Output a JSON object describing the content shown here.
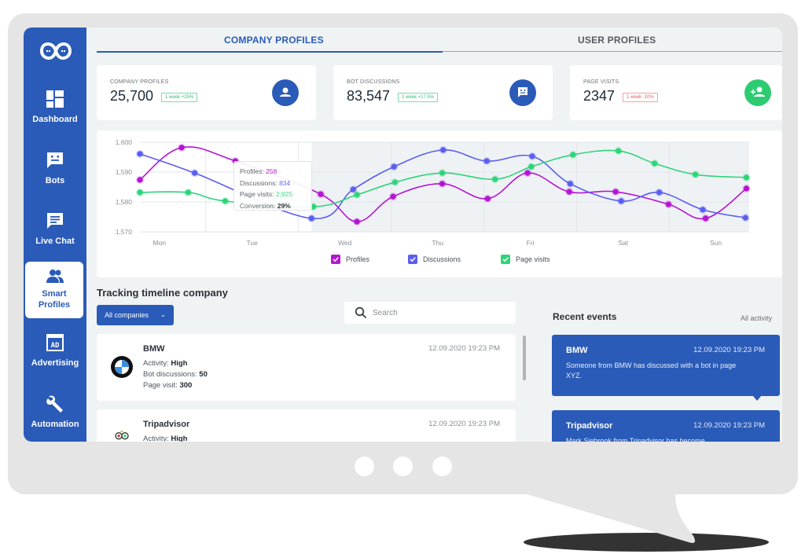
{
  "sidebar": {
    "logo": "infinity-chat-logo",
    "items": [
      {
        "label": "Dashboard",
        "icon": "dashboard-icon",
        "active": false
      },
      {
        "label": "Bots",
        "icon": "bot-chat-icon",
        "active": false
      },
      {
        "label": "Live Chat",
        "icon": "live-chat-icon",
        "active": false
      },
      {
        "label": "Smart\nProfiles",
        "label_line1": "Smart",
        "label_line2": "Profiles",
        "icon": "users-icon",
        "active": true
      },
      {
        "label": "Advertising",
        "icon": "ad-icon",
        "active": false
      },
      {
        "label": "Automation",
        "icon": "wrench-icon",
        "active": false
      }
    ]
  },
  "tabs": [
    {
      "label": "COMPANY PROFILES",
      "active": true
    },
    {
      "label": "USER PROFILES",
      "active": false
    }
  ],
  "stats": [
    {
      "title": "COMPANY PROFILES",
      "value": "25,700",
      "badge": "1 week +25%",
      "trend": "up",
      "icon": "person-icon",
      "icon_color": "#2a5bb8"
    },
    {
      "title": "BOT DISCUSSIONS",
      "value": "83,547",
      "badge": "1 week +17.5%",
      "trend": "up",
      "icon": "bot-chat-icon",
      "icon_color": "#2a5bb8"
    },
    {
      "title": "PAGE VISITS",
      "value": "2347",
      "badge": "1 week -10%",
      "trend": "down",
      "icon": "add-person-icon",
      "icon_color": "#2ecc71"
    }
  ],
  "chart_data": {
    "type": "line",
    "title": "",
    "xlabel": "",
    "ylabel": "",
    "categories": [
      "Mon",
      "Tue",
      "Wed",
      "Thu",
      "Fri",
      "Sat",
      "Sun"
    ],
    "xlim": [
      -0.21,
      6.36
    ],
    "ylim": [
      1570,
      1600
    ],
    "yticks": [
      1570,
      1580,
      1590,
      1600
    ],
    "ytick_labels": [
      "1,570",
      "1,580",
      "1,590",
      "1,600"
    ],
    "grid": true,
    "legend_position": "bottom",
    "smooth": true,
    "highlight_range": [
      1.64,
      6.36
    ],
    "series": [
      {
        "name": "Profiles",
        "color": "#b515d4",
        "x": [
          -0.21,
          0.24,
          0.82,
          1.74,
          2.13,
          2.52,
          3.05,
          3.54,
          3.97,
          4.42,
          4.92,
          5.49,
          5.89,
          6.33
        ],
        "values": [
          1587.4,
          1598.2,
          1593.7,
          1582.6,
          1573.4,
          1581.8,
          1586.1,
          1581.1,
          1589.7,
          1583.4,
          1583.4,
          1579.2,
          1574.5,
          1584.5
        ]
      },
      {
        "name": "Discussions",
        "color": "#5a5ef0",
        "x": [
          -0.21,
          0.38,
          1.64,
          2.09,
          2.53,
          3.06,
          3.53,
          4.02,
          4.43,
          4.98,
          5.39,
          5.86,
          6.32
        ],
        "values": [
          1596.1,
          1589.7,
          1574.5,
          1584.2,
          1591.8,
          1597.4,
          1593.7,
          1595.3,
          1586.1,
          1580.3,
          1583.2,
          1577.4,
          1574.7
        ]
      },
      {
        "name": "Page visits",
        "color": "#2ed47a",
        "x": [
          -0.21,
          0.31,
          0.71,
          1.66,
          2.13,
          2.54,
          3.05,
          3.62,
          4.01,
          4.46,
          4.95,
          5.34,
          5.78,
          6.33
        ],
        "values": [
          1583.2,
          1583.2,
          1580.3,
          1578.4,
          1582.4,
          1586.6,
          1589.7,
          1587.6,
          1591.8,
          1595.8,
          1597.1,
          1592.9,
          1589.2,
          1588.2
        ]
      }
    ],
    "tooltip": {
      "rows": [
        {
          "label": "Profiles: ",
          "value": "258",
          "color": "#b515d4"
        },
        {
          "label": "Discussions: ",
          "value": "834",
          "color": "#5a5ef0"
        },
        {
          "label": "Page visits: ",
          "value": "2,925",
          "color": "#2ed47a"
        },
        {
          "label": "Conversion: ",
          "value": "29%",
          "color": "#1f252c"
        }
      ]
    }
  },
  "tracking": {
    "title": "Tracking timeline company",
    "filter_label": "All companies",
    "search_placeholder": "Search",
    "items": [
      {
        "name": "BMW",
        "timestamp": "12.09.2020 19:23 PM",
        "logo": "bmw-logo",
        "lines": [
          {
            "label": "Activity: ",
            "value": "High"
          },
          {
            "label": "Bot discussions: ",
            "value": "50"
          },
          {
            "label": "Page visit: ",
            "value": "300"
          }
        ]
      },
      {
        "name": "Tripadvisor",
        "timestamp": "12.09.2020 19:23 PM",
        "logo": "tripadvisor-logo",
        "lines": [
          {
            "label": "Activity: ",
            "value": "High"
          }
        ]
      }
    ]
  },
  "recent": {
    "title": "Recent events",
    "all_label": "All activity",
    "events": [
      {
        "name": "BMW",
        "timestamp": "12.09.2020 19:23 PM",
        "text": "Someone from BMW has discussed with a bot in page XYZ."
      },
      {
        "name": "Tripadvisor",
        "timestamp": "12.09.2020 19:23 PM",
        "text": "Mark Siebrook from Tripadvisor has become"
      }
    ]
  },
  "colors": {
    "brand": "#2a5bb8",
    "success": "#2ecc71",
    "danger": "#e0605a"
  }
}
